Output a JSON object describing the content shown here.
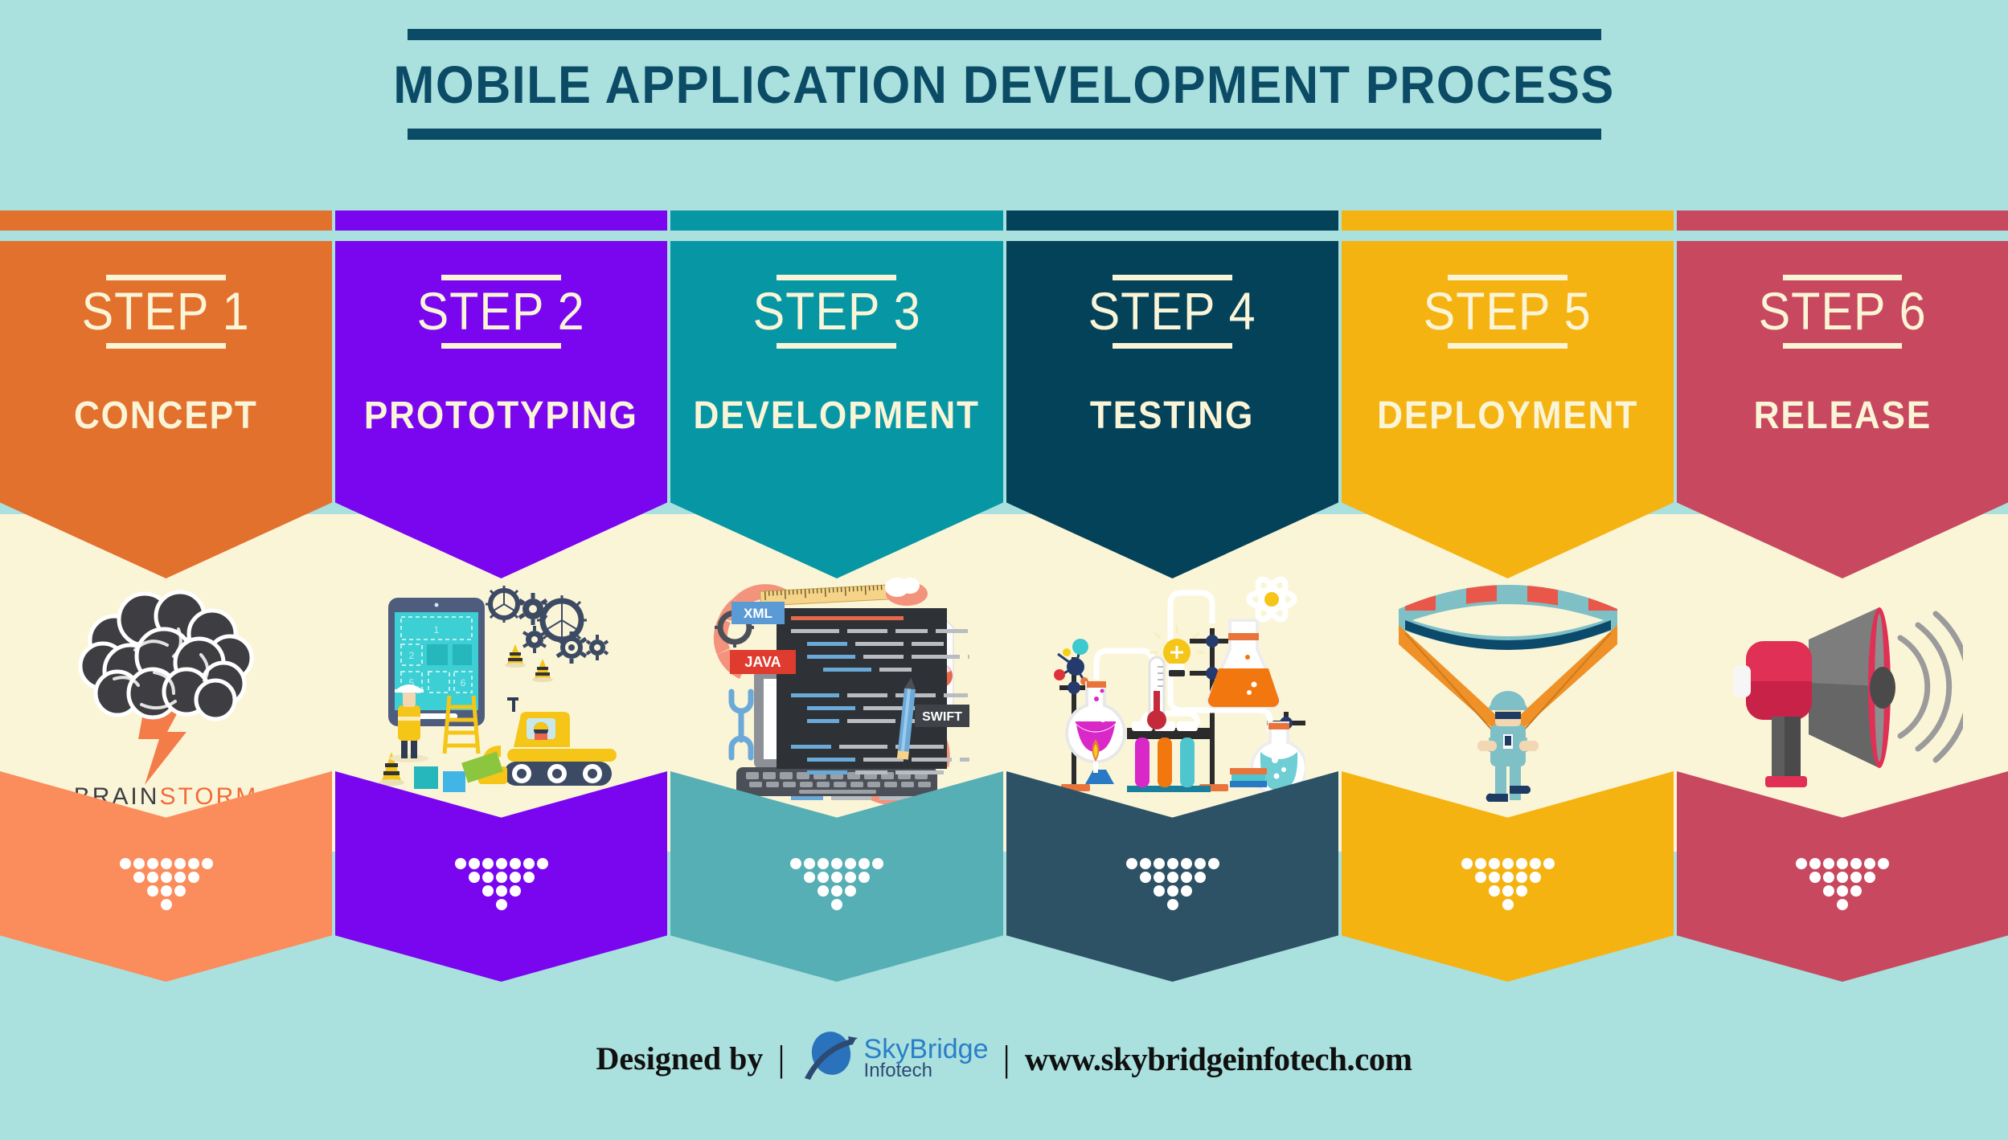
{
  "header": {
    "title": "MOBILE APPLICATION DEVELOPMENT PROCESS",
    "title_color": "#0b4b66"
  },
  "theme": {
    "page_background": "#aae0dd",
    "band_background": "#fbf5d8",
    "label_text_color": "#fbf5d8"
  },
  "steps": [
    {
      "number": "STEP 1",
      "name": "CONCEPT",
      "color": "#e2712e",
      "foot_color": "#fb8c5c",
      "icon": "brainstorm-brain-icon",
      "art_labels": {
        "brain": "BRAIN",
        "storm": "STORM"
      }
    },
    {
      "number": "STEP 2",
      "name": "PROTOTYPING",
      "color": "#7a06f0",
      "foot_color": "#7a06f0",
      "icon": "construction-tablet-icon",
      "art_labels": {}
    },
    {
      "number": "STEP 3",
      "name": "DEVELOPMENT",
      "color": "#0797a4",
      "foot_color": "#55afb5",
      "icon": "laptop-code-icon",
      "art_labels": {
        "xml": "XML",
        "java": "JAVA",
        "swift": "SWIFT"
      }
    },
    {
      "number": "STEP 4",
      "name": "TESTING",
      "color": "#044259",
      "foot_color": "#2d5266",
      "icon": "lab-flasks-icon",
      "art_labels": {}
    },
    {
      "number": "STEP 5",
      "name": "DEPLOYMENT",
      "color": "#f5b312",
      "foot_color": "#f5b312",
      "icon": "parachute-icon",
      "art_labels": {}
    },
    {
      "number": "STEP 6",
      "name": "RELEASE",
      "color": "#c8495f",
      "foot_color": "#c8495f",
      "icon": "megaphone-icon",
      "art_labels": {}
    }
  ],
  "footer": {
    "designed_by": "Designed by",
    "separator": "|",
    "logo_name": "SkyBridge",
    "logo_sub": "Infotech",
    "url": "www.skybridgeinfotech.com"
  }
}
